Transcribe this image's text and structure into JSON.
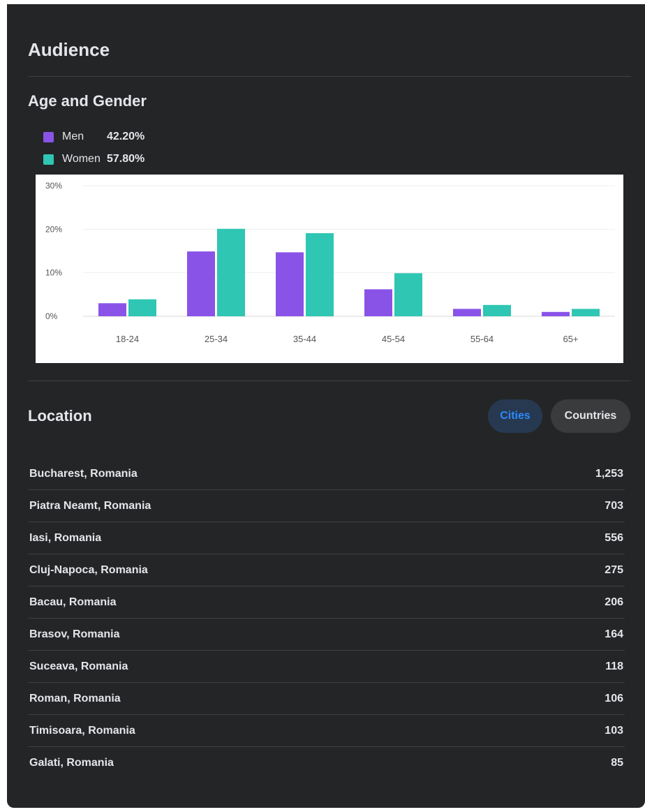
{
  "header": {
    "title": "Audience"
  },
  "age_gender": {
    "title": "Age and Gender",
    "legend": [
      {
        "label": "Men",
        "value": "42.20%",
        "color": "#8a53e8"
      },
      {
        "label": "Women",
        "value": "57.80%",
        "color": "#2fc6b3"
      }
    ]
  },
  "chart_data": {
    "type": "bar",
    "categories": [
      "18-24",
      "25-34",
      "35-44",
      "45-54",
      "55-64",
      "65+"
    ],
    "series": [
      {
        "name": "Men",
        "values": [
          3.0,
          14.9,
          14.7,
          6.2,
          1.7,
          1.0
        ],
        "color": "#8a53e8"
      },
      {
        "name": "Women",
        "values": [
          3.9,
          20.1,
          19.1,
          9.9,
          2.6,
          1.7
        ],
        "color": "#2fc6b3"
      }
    ],
    "y_ticks": [
      "0%",
      "10%",
      "20%",
      "30%"
    ],
    "ylim": [
      0,
      30
    ],
    "grid": true
  },
  "location": {
    "title": "Location",
    "tabs": {
      "cities": "Cities",
      "countries": "Countries"
    },
    "rows": [
      {
        "name": "Bucharest, Romania",
        "count": "1,253"
      },
      {
        "name": "Piatra Neamt, Romania",
        "count": "703"
      },
      {
        "name": "Iasi, Romania",
        "count": "556"
      },
      {
        "name": "Cluj-Napoca, Romania",
        "count": "275"
      },
      {
        "name": "Bacau, Romania",
        "count": "206"
      },
      {
        "name": "Brasov, Romania",
        "count": "164"
      },
      {
        "name": "Suceava, Romania",
        "count": "118"
      },
      {
        "name": "Roman, Romania",
        "count": "106"
      },
      {
        "name": "Timisoara, Romania",
        "count": "103"
      },
      {
        "name": "Galati, Romania",
        "count": "85"
      }
    ]
  }
}
